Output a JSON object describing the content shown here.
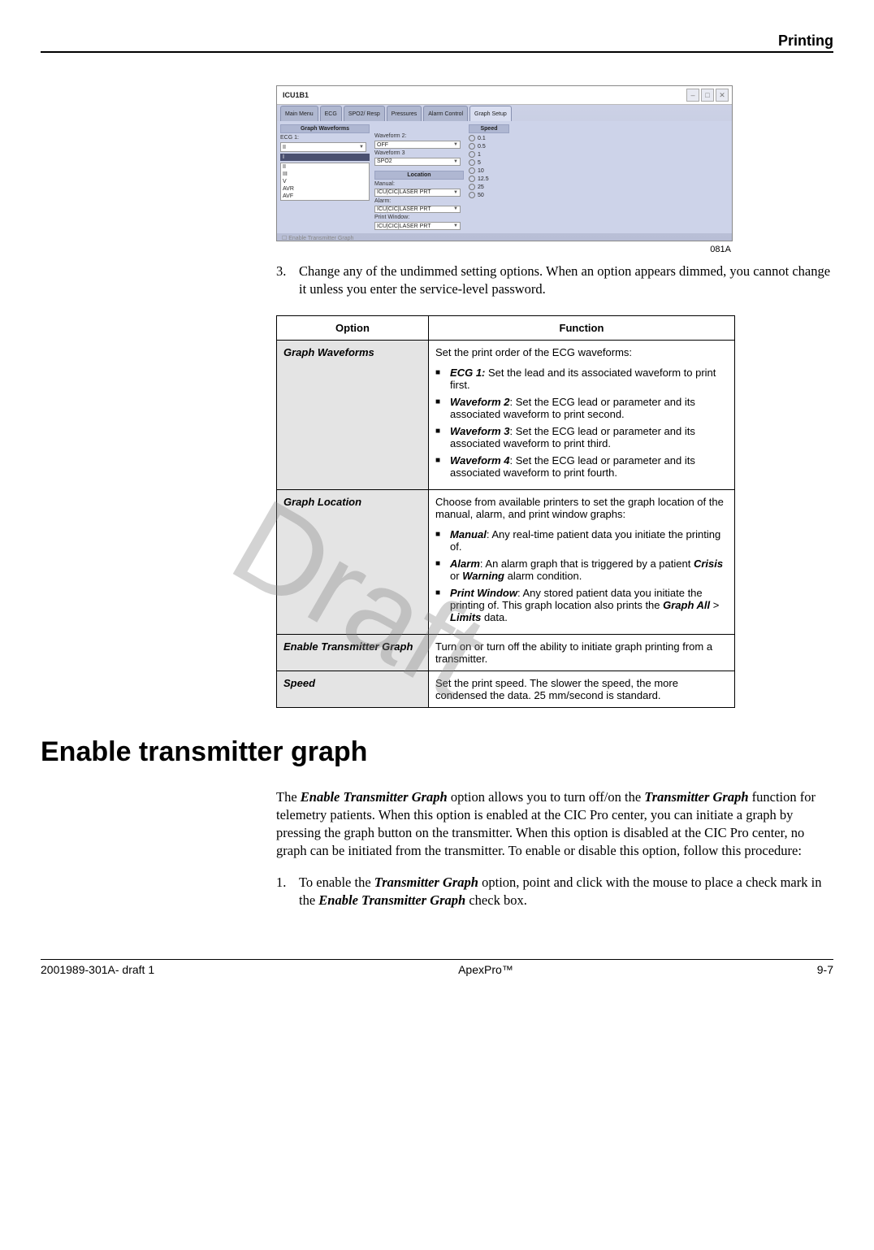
{
  "header": {
    "section": "Printing"
  },
  "watermark": "Draft",
  "screenshot": {
    "image_ref": "081A",
    "title": "ICU1B1",
    "tabs": [
      "Main Menu",
      "ECG",
      "SPO2/ Resp",
      "Pressures",
      "Alarm Control",
      "Graph Setup"
    ],
    "group_waveforms": "Graph Waveforms",
    "group_location": "Location",
    "group_speed": "Speed",
    "ecg1_label": "ECG 1:",
    "ecg1_value": "II",
    "ecg_leads": [
      "I",
      "II",
      "III",
      "V",
      "AVR",
      "AVF"
    ],
    "w2_label": "Waveform 2:",
    "w2_value": "OFF",
    "w3_label": "Waveform 3",
    "w3_value": "SPO2",
    "manual_label": "Manual:",
    "manual_value": "ICU|CIC|LASER PRT",
    "alarm_label": "Alarm:",
    "alarm_value": "ICU|CIC|LASER PRT",
    "printwin_label": "Print Window:",
    "printwin_value": "ICU|CIC|LASER PRT",
    "speeds": [
      "0.1",
      "0.5",
      "1",
      "5",
      "10",
      "12.5",
      "25",
      "50"
    ],
    "checkbox": "Enable Transmitter Graph"
  },
  "step3": {
    "num": "3.",
    "text": "Change any of the undimmed setting options. When an option appears dimmed, you cannot change it unless you enter the service-level password."
  },
  "table": {
    "headers": {
      "option": "Option",
      "function": "Function"
    },
    "rows": [
      {
        "option": "Graph Waveforms",
        "intro": "Set the print order of the ECG waveforms:",
        "items": [
          {
            "bold": "ECG 1:",
            "text": " Set the lead and its associated waveform to print first."
          },
          {
            "bold": "Waveform 2",
            "text": ": Set the ECG lead or parameter and its associated waveform to print second."
          },
          {
            "bold": "Waveform 3",
            "text": ": Set the ECG lead or parameter and its associated waveform to print third."
          },
          {
            "bold": "Waveform 4",
            "text": ": Set the ECG lead or parameter and its associated waveform to print fourth."
          }
        ]
      },
      {
        "option": "Graph Location",
        "intro": "Choose from available printers to set the graph location of the manual, alarm, and print window graphs:",
        "items": [
          {
            "bold": "Manual",
            "text": ": Any real-time patient data you initiate the printing of."
          },
          {
            "bold": "Alarm",
            "text_pre": ": An alarm graph that is triggered by a patient ",
            "bold2": "Crisis",
            "mid": " or ",
            "bold3": "Warning",
            "text_post": " alarm condition."
          },
          {
            "bold": "Print Window",
            "text_pre": ": Any stored patient data you initiate the printing of. This graph location also prints the ",
            "bold2": "Graph All",
            "mid": " > ",
            "bold3": "Limits",
            "text_post": " data."
          }
        ]
      },
      {
        "option": "Enable Transmitter Graph",
        "plain": "Turn on or turn off the ability to initiate graph printing from a transmitter."
      },
      {
        "option": "Speed",
        "plain": "Set the print speed. The slower the speed, the more condensed the data. 25 mm/second is standard."
      }
    ]
  },
  "section_title": "Enable transmitter graph",
  "para1": {
    "p1": "The ",
    "b1": "Enable Transmitter Graph",
    "p2": " option allows you to turn off/on the ",
    "b2": "Transmitter Graph",
    "p3": " function for telemetry patients. When this option is enabled at the CIC Pro center, you can initiate a graph by pressing the graph button on the transmitter. When this option is disabled at the CIC Pro center, no graph can be initiated from the transmitter. To enable or disable this option, follow this procedure:"
  },
  "step1": {
    "num": "1.",
    "p1": "To enable the ",
    "b1": "Transmitter Graph",
    "p2": " option, point and click with the mouse to place a check mark in the ",
    "b2": "Enable Transmitter Graph",
    "p3": " check box."
  },
  "footer": {
    "left": "2001989-301A- draft 1",
    "center": "ApexPro™",
    "right": "9-7"
  }
}
